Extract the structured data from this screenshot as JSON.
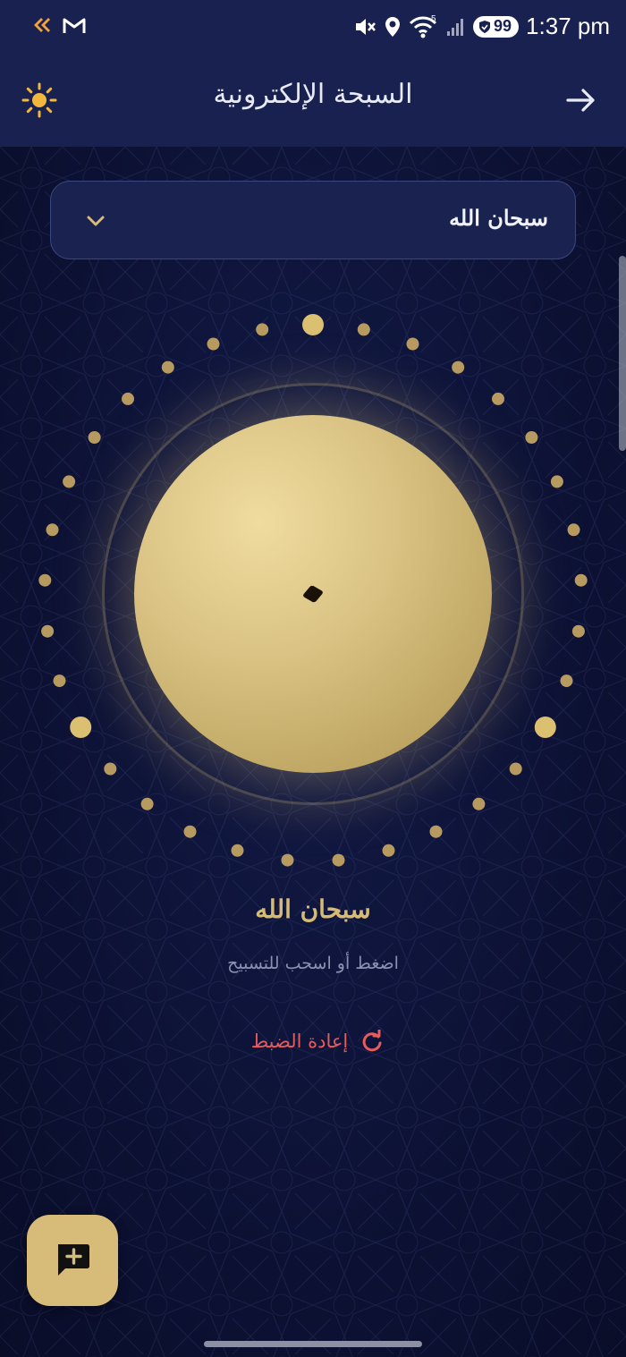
{
  "status_bar": {
    "time": "1:37 pm",
    "battery": "99",
    "network": "5",
    "left_icons": [
      "app-notification-icon",
      "gmail-icon"
    ],
    "right_icons": [
      "mute-icon",
      "location-icon",
      "wifi-icon",
      "signal-icon",
      "battery-icon"
    ]
  },
  "app_bar": {
    "title": "السبحة الإلكترونية",
    "left_icon": "sun-icon",
    "right_icon": "arrow-right-icon"
  },
  "dhikr_select": {
    "selected": "سبحان الله",
    "icon": "chevron-down-icon"
  },
  "counter": {
    "dhikr_label": "سبحان الله",
    "hint": "اضغط أو اسحب للتسبيح",
    "total_beads": 33,
    "highlighted_beads": 3
  },
  "reset": {
    "label": "إعادة الضبط",
    "icon": "refresh-icon"
  },
  "fab": {
    "icon": "add-comment-icon"
  },
  "colors": {
    "background": "#0c1030",
    "app_bar": "#18214f",
    "gold": "#d7bb78",
    "reset_red": "#e65b5b"
  }
}
